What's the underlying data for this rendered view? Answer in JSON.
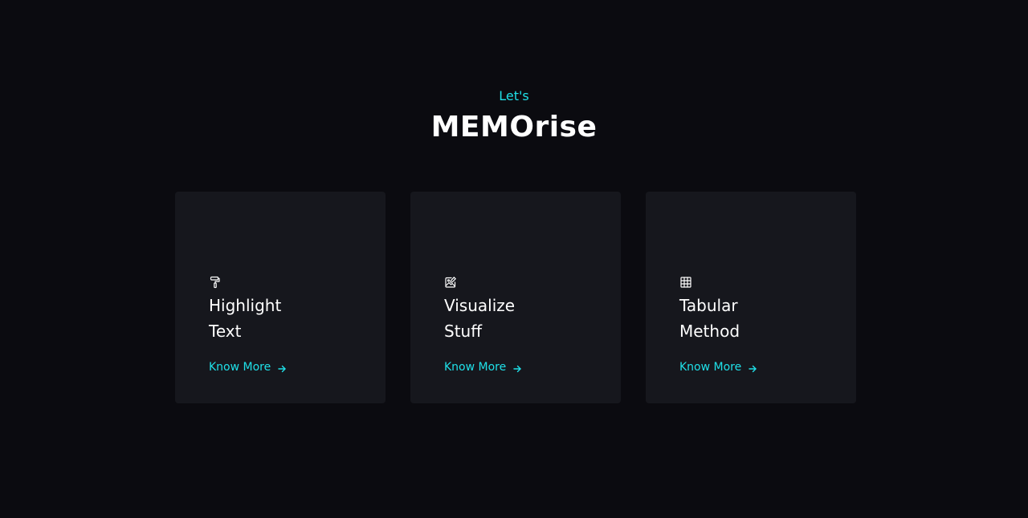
{
  "header": {
    "eyebrow": "Let's",
    "title": "MEMOrise"
  },
  "colors": {
    "background": "#0b0b10",
    "card": "#16171d",
    "accent": "#1fe0e8",
    "text": "#ffffff"
  },
  "cards": [
    {
      "icon": "paint-roller-icon",
      "title_line1": "Highlight",
      "title_line2": "Text",
      "link": "Know More"
    },
    {
      "icon": "edit-image-icon",
      "title_line1": "Visualize",
      "title_line2": "Stuff",
      "link": "Know More"
    },
    {
      "icon": "table-icon",
      "title_line1": "Tabular",
      "title_line2": "Method",
      "link": "Know More"
    }
  ]
}
